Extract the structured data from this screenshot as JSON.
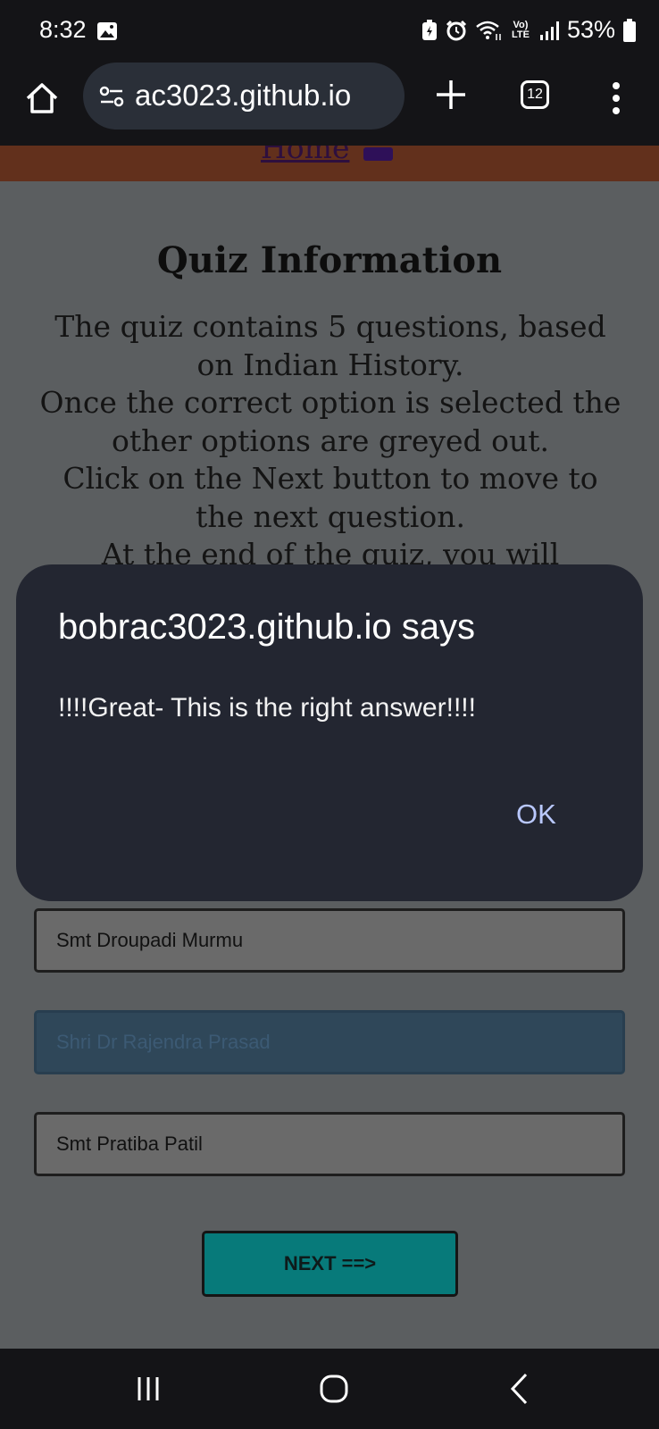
{
  "status_bar": {
    "time": "8:32",
    "battery_percent": "53%",
    "network_label": "Vo) LTE",
    "icons": [
      "gallery-icon",
      "battery-saver-icon",
      "alarm-icon",
      "wifi-icon",
      "volte-icon",
      "signal-icon",
      "battery-icon"
    ]
  },
  "browser": {
    "url": "ac3023.github.io",
    "tab_count": "12"
  },
  "site": {
    "home_link": "Home"
  },
  "quiz": {
    "title": "Quiz Information",
    "info_lines": [
      "The quiz contains 5 questions, based on Indian History.",
      "Once the correct option is selected the other options are greyed out.",
      "Click on the Next button to move to the next question.",
      "At the end of the quiz, you will"
    ],
    "options": [
      {
        "label": "Smt Droupadi Murmu",
        "state": "greyed"
      },
      {
        "label": "Shri Dr Rajendra Prasad",
        "state": "correct"
      },
      {
        "label": "Smt Pratiba Patil",
        "state": "greyed"
      }
    ],
    "next_label": "NEXT ==>"
  },
  "dialog": {
    "title": "bobrac3023.github.io says",
    "message": "!!!!Great- This is the right answer!!!!",
    "ok_label": "OK"
  },
  "colors": {
    "dialog_bg": "#232631",
    "ok_text": "#b9c8ff",
    "correct_option": "#2f4759",
    "next_button": "#077a7a",
    "header_band": "#62301c"
  }
}
